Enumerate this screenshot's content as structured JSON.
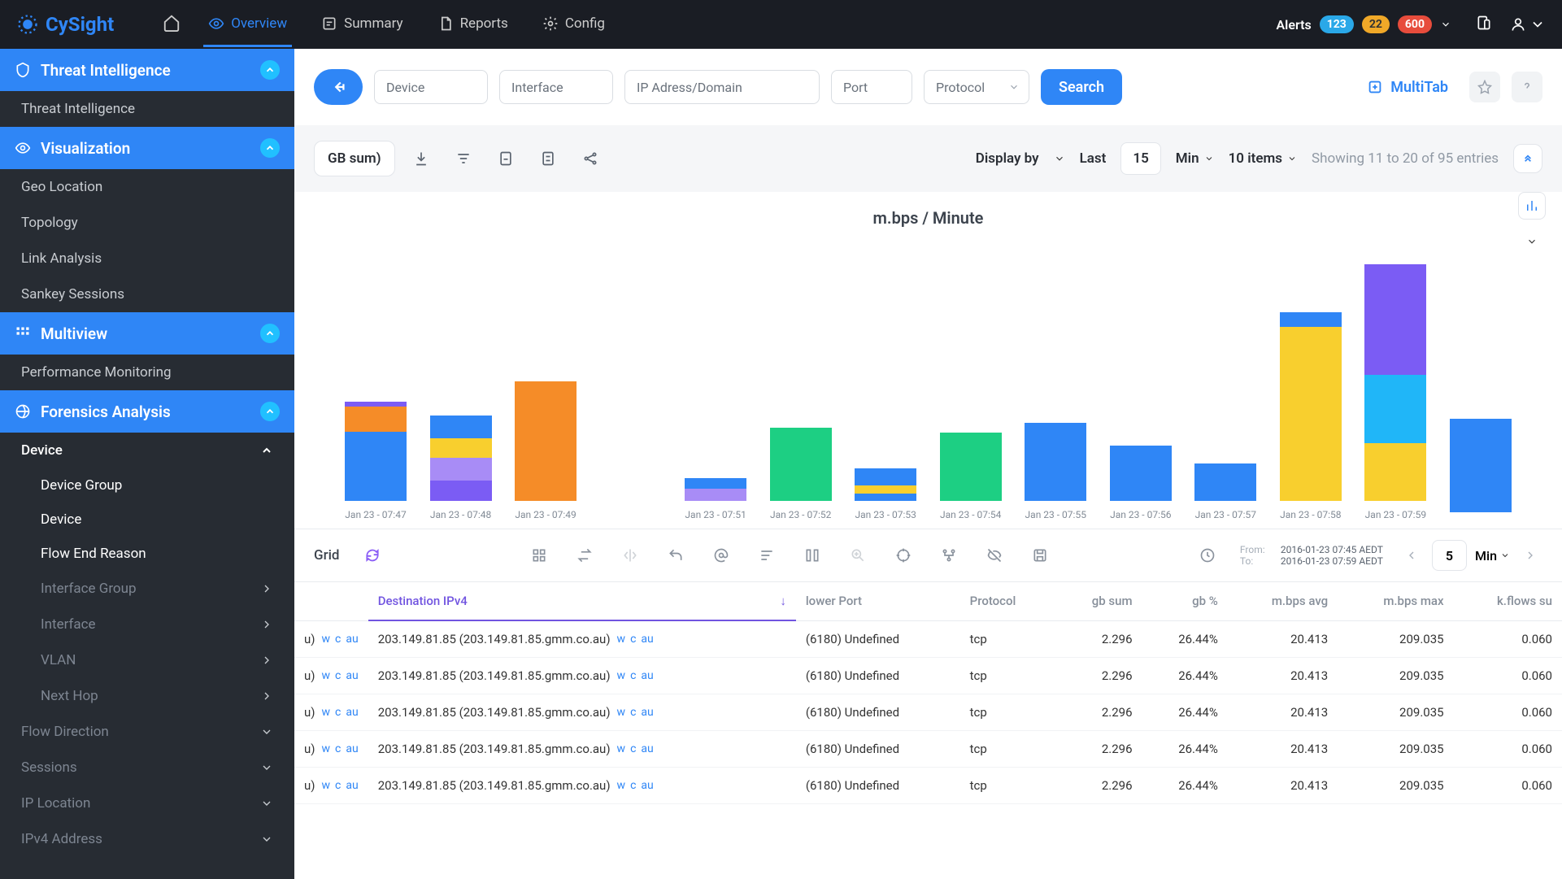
{
  "brand": "CySight",
  "nav": [
    {
      "label": "Overview",
      "active": true
    },
    {
      "label": "Summary",
      "active": false
    },
    {
      "label": "Reports",
      "active": false
    },
    {
      "label": "Config",
      "active": false
    }
  ],
  "alerts": {
    "label": "Alerts",
    "blue": "123",
    "orange": "22",
    "red": "600"
  },
  "sidebar": {
    "sections": [
      {
        "title": "Threat Intelligence",
        "items": [
          {
            "label": "Threat Intelligence"
          }
        ]
      },
      {
        "title": "Visualization",
        "items": [
          {
            "label": "Geo Location"
          },
          {
            "label": "Topology"
          },
          {
            "label": "Link Analysis"
          },
          {
            "label": "Sankey Sessions"
          }
        ]
      },
      {
        "title": "Multiview",
        "items": [
          {
            "label": "Performance Monitoring"
          }
        ]
      },
      {
        "title": "Forensics Analysis",
        "group": {
          "label": "Device",
          "open": true,
          "sub": [
            {
              "label": "Device Group"
            },
            {
              "label": "Device"
            },
            {
              "label": "Flow End Reason"
            }
          ],
          "after": [
            {
              "label": "Interface Group",
              "chev": true
            },
            {
              "label": "Interface",
              "chev": true
            },
            {
              "label": "VLAN",
              "chev": true
            },
            {
              "label": "Next Hop",
              "chev": true
            }
          ]
        }
      },
      {
        "extra": [
          {
            "label": "Flow Direction",
            "chev": "down"
          },
          {
            "label": "Sessions",
            "chev": "down"
          },
          {
            "label": "IP Location",
            "chev": "down"
          },
          {
            "label": "IPv4 Address",
            "chev": "down"
          }
        ]
      }
    ]
  },
  "search": {
    "device_ph": "Device",
    "interface_ph": "Interface",
    "ip_ph": "IP Adress/Domain",
    "port_ph": "Port",
    "protocol_ph": "Protocol",
    "button": "Search",
    "multitab": "MultiTab"
  },
  "controls": {
    "measure_label": "GB sum)",
    "display_by": "Display by",
    "last_label": "Last",
    "last_value": "15",
    "min_label": "Min",
    "items_label": "10 items",
    "showing": "Showing 11 to 20 of 95 entries"
  },
  "chart_data": {
    "type": "bar",
    "title": "m.bps / Minute",
    "categories": [
      "Jan 23 - 07:47",
      "Jan 23 - 07:48",
      "Jan 23 - 07:49",
      "",
      "Jan 23 - 07:51",
      "Jan 23 - 07:52",
      "Jan 23 - 07:53",
      "Jan 23 - 07:54",
      "Jan 23 - 07:55",
      "Jan 23 - 07:56",
      "Jan 23 - 07:57",
      "Jan 23 - 07:58",
      "Jan 23 - 07:59"
    ],
    "ylim": [
      0,
      200
    ],
    "stacks": [
      [
        {
          "v": 55,
          "c": "#2f86f6"
        },
        {
          "v": 20,
          "c": "#f58c28"
        },
        {
          "v": 4,
          "c": "#7b5cf4"
        }
      ],
      [
        {
          "v": 16,
          "c": "#7b5cf4"
        },
        {
          "v": 18,
          "c": "#a88cf6"
        },
        {
          "v": 16,
          "c": "#f8cf2e"
        },
        {
          "v": 18,
          "c": "#2f86f6"
        }
      ],
      [
        {
          "v": 95,
          "c": "#f58c28"
        }
      ],
      [],
      [
        {
          "v": 10,
          "c": "#a88cf6"
        },
        {
          "v": 8,
          "c": "#2f86f6"
        }
      ],
      [
        {
          "v": 58,
          "c": "#1dcf83"
        }
      ],
      [
        {
          "v": 6,
          "c": "#2f86f6"
        },
        {
          "v": 6,
          "c": "#f8cf2e"
        },
        {
          "v": 14,
          "c": "#2f86f6"
        }
      ],
      [
        {
          "v": 54,
          "c": "#1dcf83"
        }
      ],
      [
        {
          "v": 62,
          "c": "#2f86f6"
        }
      ],
      [
        {
          "v": 44,
          "c": "#2f86f6"
        }
      ],
      [
        {
          "v": 30,
          "c": "#2f86f6"
        }
      ],
      [
        {
          "v": 138,
          "c": "#f8cf2e"
        },
        {
          "v": 12,
          "c": "#2f86f6"
        }
      ],
      [
        {
          "v": 46,
          "c": "#f8cf2e"
        },
        {
          "v": 54,
          "c": "#20b6f8"
        },
        {
          "v": 88,
          "c": "#7b5cf4"
        }
      ],
      [
        {
          "v": 74,
          "c": "#2f86f6"
        }
      ]
    ]
  },
  "grid_tools": {
    "grid_label": "Grid",
    "from_label": "From:",
    "to_label": "To:",
    "from_value": "2016-01-23  07:45  AEDT",
    "to_value": "2016-01-23  07:59  AEDT",
    "page": "5",
    "min": "Min"
  },
  "table": {
    "columns": [
      {
        "label": "Destination IPv4",
        "active": true,
        "align": "left"
      },
      {
        "label": "lower Port",
        "align": "left"
      },
      {
        "label": "Protocol",
        "align": "left"
      },
      {
        "label": "gb sum",
        "align": "right"
      },
      {
        "label": "gb %",
        "align": "right"
      },
      {
        "label": "m.bps avg",
        "align": "right"
      },
      {
        "label": "m.bps max",
        "align": "right"
      },
      {
        "label": "k.flows su",
        "align": "right"
      }
    ],
    "row_prefix": "u)",
    "row_links": [
      "w",
      "c",
      "au"
    ],
    "rows": [
      {
        "dest": "203.149.81.85 (203.149.81.85.gmm.co.au)",
        "port": "(6180) Undefined",
        "proto": "tcp",
        "gb": "2.296",
        "pct": "26.44%",
        "avg": "20.413",
        "max": "209.035",
        "flow": "0.060"
      },
      {
        "dest": "203.149.81.85 (203.149.81.85.gmm.co.au)",
        "port": "(6180) Undefined",
        "proto": "tcp",
        "gb": "2.296",
        "pct": "26.44%",
        "avg": "20.413",
        "max": "209.035",
        "flow": "0.060"
      },
      {
        "dest": "203.149.81.85 (203.149.81.85.gmm.co.au)",
        "port": "(6180) Undefined",
        "proto": "tcp",
        "gb": "2.296",
        "pct": "26.44%",
        "avg": "20.413",
        "max": "209.035",
        "flow": "0.060"
      },
      {
        "dest": "203.149.81.85 (203.149.81.85.gmm.co.au)",
        "port": "(6180) Undefined",
        "proto": "tcp",
        "gb": "2.296",
        "pct": "26.44%",
        "avg": "20.413",
        "max": "209.035",
        "flow": "0.060"
      },
      {
        "dest": "203.149.81.85 (203.149.81.85.gmm.co.au)",
        "port": "(6180) Undefined",
        "proto": "tcp",
        "gb": "2.296",
        "pct": "26.44%",
        "avg": "20.413",
        "max": "209.035",
        "flow": "0.060"
      }
    ]
  }
}
